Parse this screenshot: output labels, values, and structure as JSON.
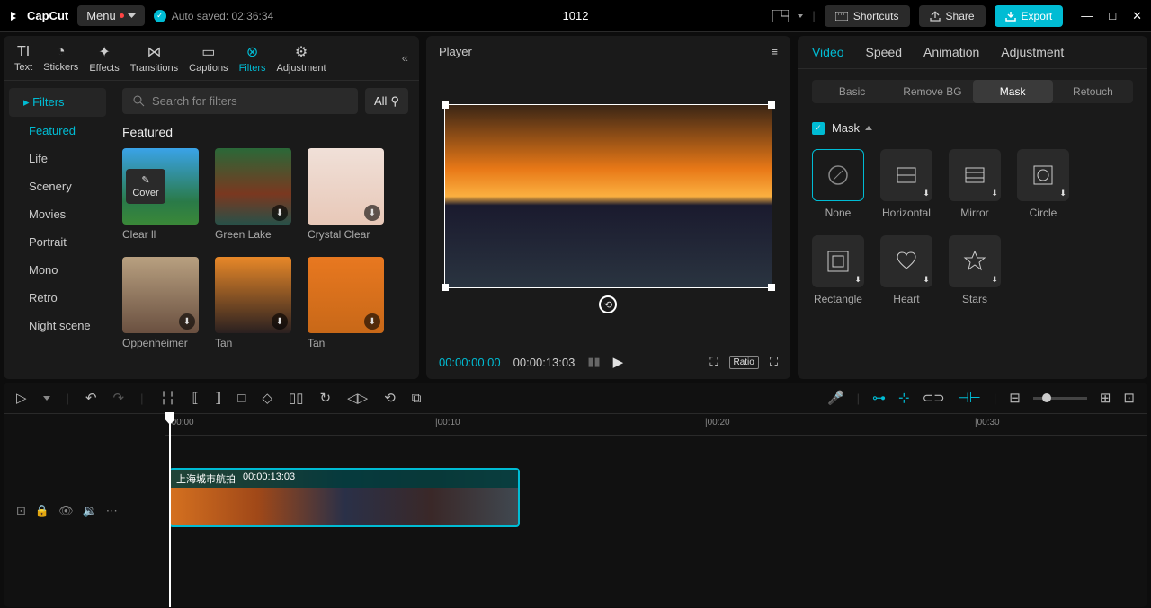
{
  "app": {
    "name": "CapCut",
    "menu": "Menu",
    "autosave": "Auto saved: 02:36:34",
    "project": "1012"
  },
  "topbar": {
    "shortcuts": "Shortcuts",
    "share": "Share",
    "export": "Export"
  },
  "left_tabs": [
    "Text",
    "Stickers",
    "Effects",
    "Transitions",
    "Captions",
    "Filters",
    "Adjustment"
  ],
  "sidebar": {
    "header": "Filters",
    "items": [
      "Featured",
      "Life",
      "Scenery",
      "Movies",
      "Portrait",
      "Mono",
      "Retro",
      "Night scene"
    ]
  },
  "search": {
    "placeholder": "Search for filters",
    "all": "All"
  },
  "section": "Featured",
  "filters": [
    {
      "name": "Clear ll",
      "g": "linear-gradient(180deg,#3aa3e8 0%,#2a7a48 70%,#3a8838 100%)"
    },
    {
      "name": "Green Lake",
      "g": "linear-gradient(180deg,#2a6838 0%,#7a3820 60%,#285048 100%)"
    },
    {
      "name": "Crystal Clear",
      "g": "linear-gradient(180deg,#f0e0d8 0%,#e8c8b8 100%)"
    },
    {
      "name": "Oppenheimer",
      "g": "linear-gradient(180deg,#b8a080 0%,#6a5040 100%)"
    },
    {
      "name": "Tan",
      "g": "linear-gradient(180deg,#e88828 0%,#2a2020 100%)"
    },
    {
      "name": "Tan",
      "g": "linear-gradient(180deg,#e87820 0%,#c86818 100%)"
    }
  ],
  "player": {
    "title": "Player",
    "time_current": "00:00:00:00",
    "time_total": "00:00:13:03",
    "ratio": "Ratio"
  },
  "right_tabs": [
    "Video",
    "Speed",
    "Animation",
    "Adjustment"
  ],
  "subtabs": [
    "Basic",
    "Remove BG",
    "Mask",
    "Retouch"
  ],
  "mask": {
    "title": "Mask",
    "items": [
      "None",
      "Horizontal",
      "Mirror",
      "Circle",
      "Rectangle",
      "Heart",
      "Stars"
    ]
  },
  "ruler": [
    "|00:00",
    "|00:10",
    "|00:20",
    "|00:30"
  ],
  "clip": {
    "name": "上海城市航拍",
    "dur": "00:00:13:03"
  },
  "cover": "Cover"
}
